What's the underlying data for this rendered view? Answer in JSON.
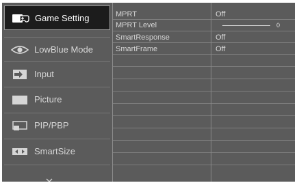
{
  "menu": {
    "items": [
      {
        "label": "Game Setting",
        "icon": "gamepad-icon",
        "active": true
      },
      {
        "label": "LowBlue Mode",
        "icon": "eye-icon",
        "active": false
      },
      {
        "label": "Input",
        "icon": "input-icon",
        "active": false
      },
      {
        "label": "Picture",
        "icon": "picture-icon",
        "active": false
      },
      {
        "label": "PIP/PBP",
        "icon": "pip-icon",
        "active": false
      },
      {
        "label": "SmartSize",
        "icon": "smartsize-icon",
        "active": false
      }
    ],
    "more_icon": "chevron-down-icon"
  },
  "options": [
    {
      "label": "MPRT",
      "value": "Off"
    },
    {
      "label": "MPRT Level",
      "value": "0"
    },
    {
      "label": "SmartResponse",
      "value": "Off"
    },
    {
      "label": "SmartFrame",
      "value": "Off"
    }
  ],
  "mprt_level": {
    "value": 0
  },
  "colors": {
    "panel": "#5b5b5b",
    "active_bg": "#1c1c1c",
    "text": "#d6d6d6"
  }
}
